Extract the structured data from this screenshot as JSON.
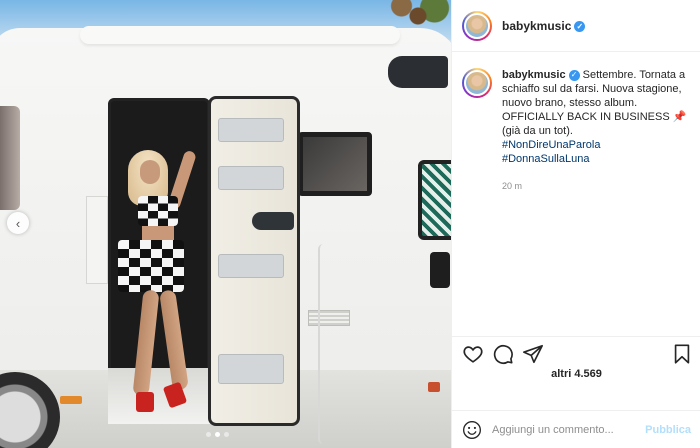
{
  "post": {
    "username": "babykmusic",
    "verified_icon": "verified-badge-icon",
    "caption_user": "babykmusic",
    "caption_lines": [
      "Settembre. Tornata a",
      "schiaffo sul da farsi. Nuova stagione,",
      "nuovo brano, stesso album.",
      "OFFICIALLY BACK IN BUSINESS",
      "(già da un tot)."
    ],
    "pin_emoji": "📌",
    "hashtags": [
      "#NonDireUnaParola",
      "#DonnaSullaLuna"
    ],
    "time": "20 m",
    "likes": "altri 4.569"
  },
  "actions": {
    "icons": [
      "heart-icon",
      "comment-icon",
      "share-icon",
      "bookmark-icon"
    ]
  },
  "comment": {
    "placeholder": "Aggiungi un commento...",
    "publish_label": "Pubblica",
    "emoji_icon": "smiley-icon"
  },
  "carousel": {
    "prev_arrow": "‹",
    "dots": 3,
    "active_dot": 1
  },
  "colors": {
    "accent": "#3897f0",
    "link": "#00376b",
    "muted": "#8e8e8e",
    "publish_disabled": "#b2dffc"
  }
}
